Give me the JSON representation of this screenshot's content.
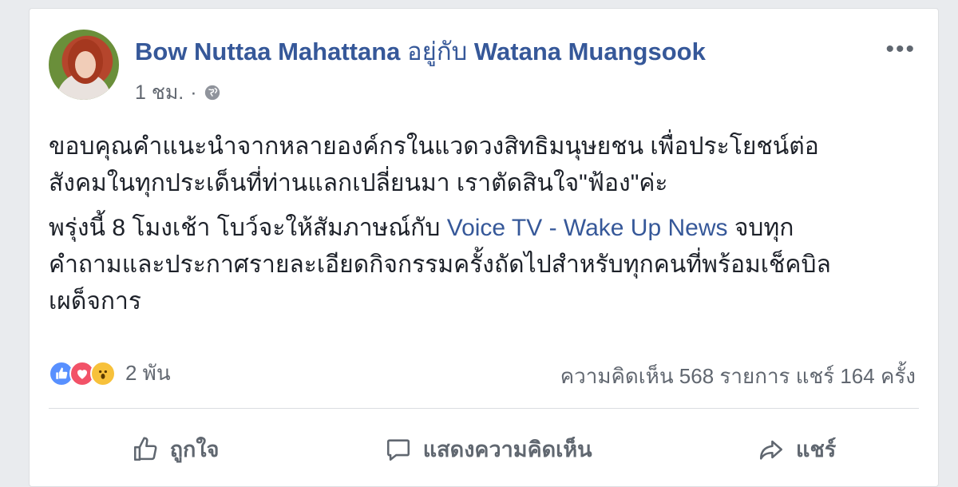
{
  "post": {
    "author": "Bow Nuttaa Mahattana",
    "with_label": "อยู่กับ",
    "with_name": "Watana Muangsook",
    "time": "1 ชม.",
    "separator": "·",
    "more_label": "•••",
    "body": {
      "p1_line1": "ขอบคุณคำแนะนำจากหลายองค์กรในแวดวงสิทธิมนุษยชน เพื่อประโยชน์ต่อ",
      "p1_line2": "สังคมในทุกประเด็นที่ท่านแลกเปลี่ยนมา เราตัดสินใจ\"ฟ้อง\"ค่ะ",
      "p2_before": "พรุ่งนี้ 8 โมงเช้า โบว์จะให้สัมภาษณ์กับ ",
      "p2_link": "Voice TV - Wake Up News",
      "p2_after": " จบทุก",
      "p2_line2": "คำถามและประกาศรายละเอียดกิจกรรมครั้งถัดไปสำหรับทุกคนที่พร้อมเช็คบิล",
      "p2_line3": "เผด็จการ"
    },
    "reactions": {
      "icons": [
        "like-icon",
        "love-icon",
        "wow-icon"
      ],
      "count": "2 พัน"
    },
    "stats": "ความคิดเห็น 568 รายการ  แชร์ 164 ครั้ง",
    "actions": {
      "like": "ถูกใจ",
      "comment": "แสดงความคิดเห็น",
      "share": "แชร์"
    }
  },
  "colors": {
    "link": "#365899",
    "like": "#5890ff",
    "love": "#f25268",
    "wow": "#f7c13b"
  }
}
